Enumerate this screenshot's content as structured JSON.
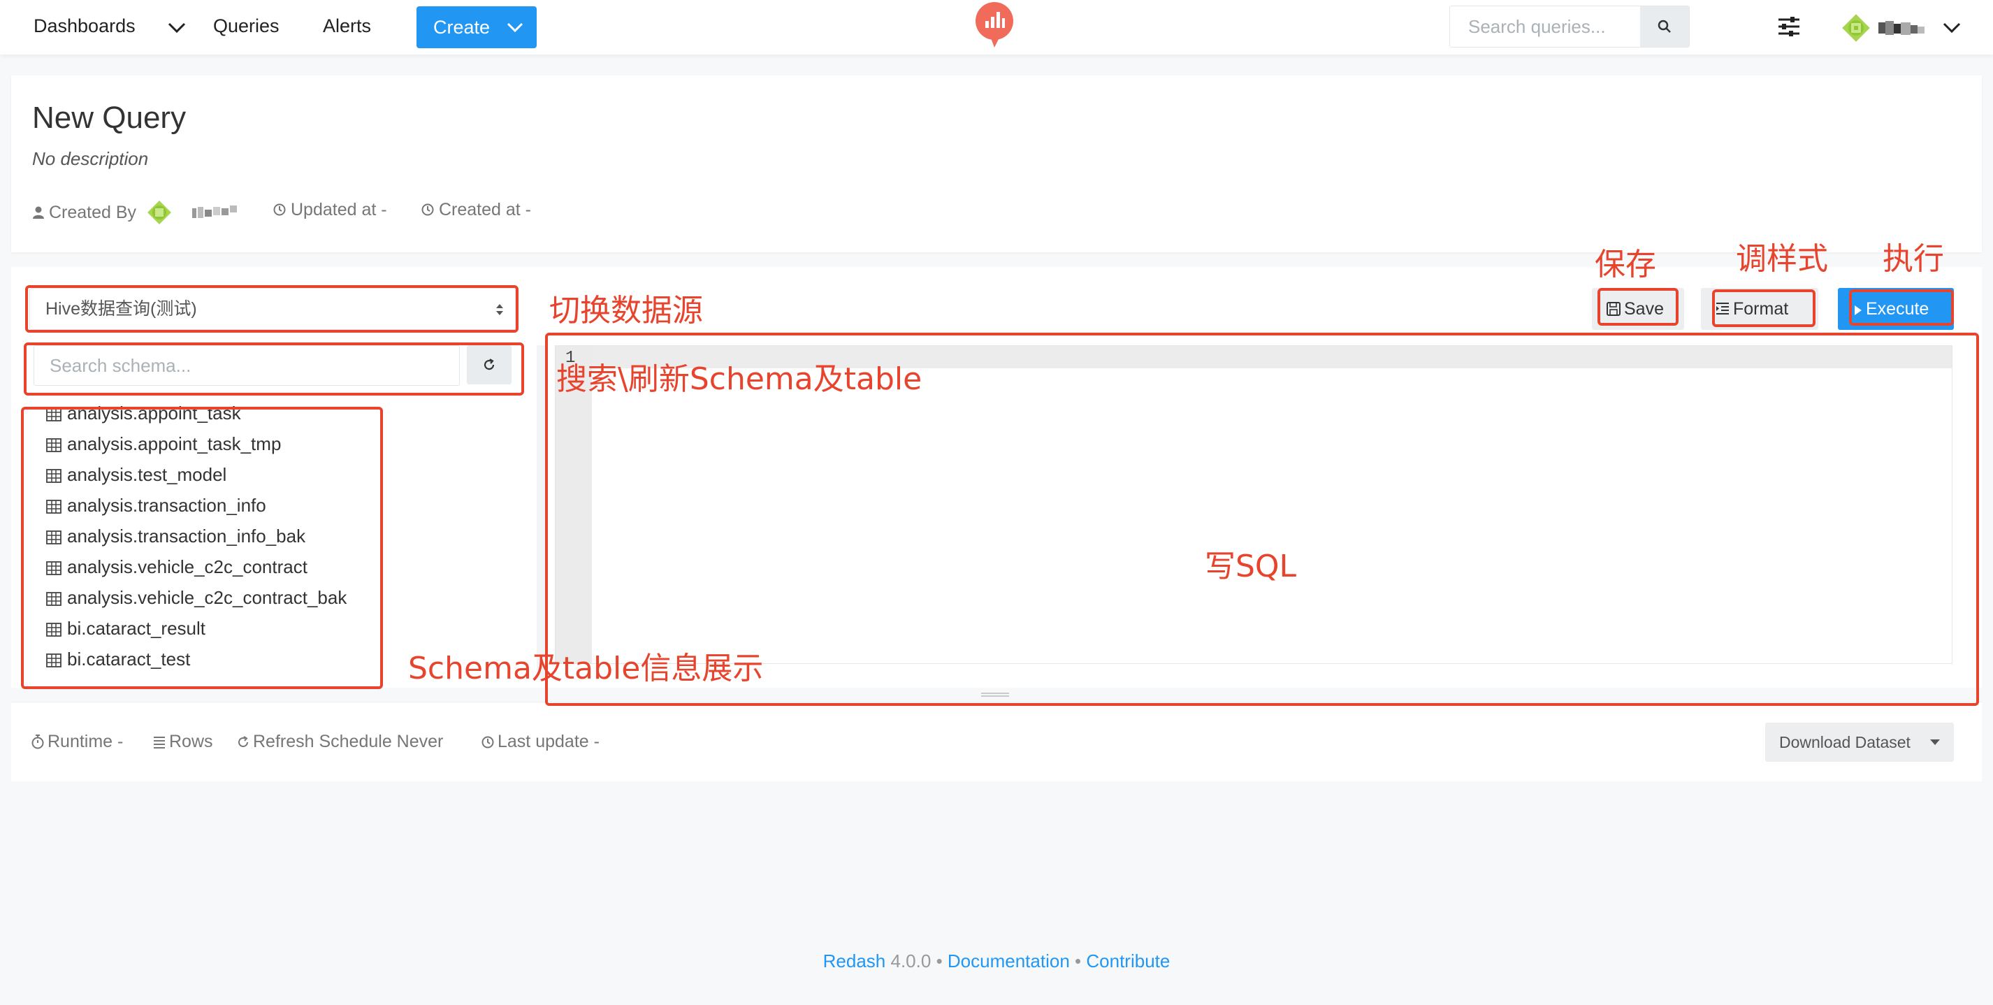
{
  "nav": {
    "dashboards": "Dashboards",
    "queries": "Queries",
    "alerts": "Alerts",
    "create": "Create",
    "search_placeholder": "Search queries..."
  },
  "query": {
    "title": "New Query",
    "description": "No description",
    "created_by_label": "Created By",
    "updated_at": "Updated at -",
    "created_at": "Created at -"
  },
  "editor": {
    "data_source": "Hive数据查询(测试)",
    "schema_search_placeholder": "Search schema...",
    "save": "Save",
    "format": "Format",
    "execute": "Execute",
    "line_number": "1"
  },
  "schema": {
    "tables": [
      "analysis.appoint_task",
      "analysis.appoint_task_tmp",
      "analysis.test_model",
      "analysis.transaction_info",
      "analysis.transaction_info_bak",
      "analysis.vehicle_c2c_contract",
      "analysis.vehicle_c2c_contract_bak",
      "bi.cataract_result",
      "bi.cataract_test"
    ]
  },
  "results": {
    "runtime": "Runtime -",
    "rows": "Rows",
    "refresh": "Refresh Schedule Never",
    "last_update": "Last update -",
    "download": "Download Dataset"
  },
  "footer": {
    "redash": "Redash",
    "version": "4.0.0",
    "sep1": "•",
    "documentation": "Documentation",
    "sep2": "•",
    "contribute": "Contribute"
  },
  "annotations": {
    "switch_source": "切换数据源",
    "search_refresh": "搜索\\刷新Schema及table",
    "schema_info": "Schema及table信息展示",
    "write_sql": "写SQL",
    "save": "保存",
    "format": "调样式",
    "execute": "执行"
  },
  "colors": {
    "accent": "#2196f3",
    "annotation": "#e8432d",
    "logo": "#f16b5b"
  }
}
